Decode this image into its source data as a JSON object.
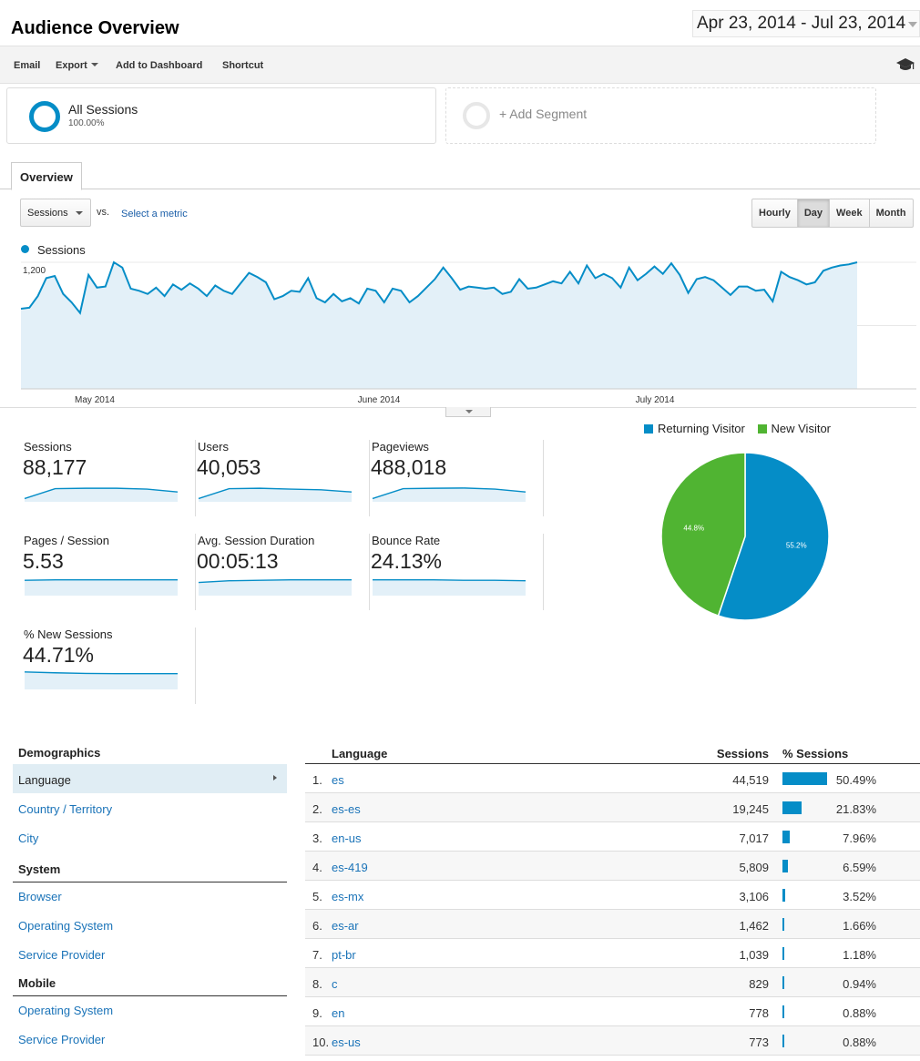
{
  "header": {
    "title": "Audience Overview",
    "date_range": "Apr 23, 2014 - Jul 23, 2014"
  },
  "toolbar": {
    "email": "Email",
    "export": "Export",
    "add_to_dashboard": "Add to Dashboard",
    "shortcut": "Shortcut",
    "icon": "graduation-cap-icon"
  },
  "segments": {
    "all_sessions": {
      "label": "All Sessions",
      "percent": "100.00%"
    },
    "add_segment": "+ Add Segment"
  },
  "tabs": {
    "overview": "Overview"
  },
  "chart_controls": {
    "metric": "Sessions",
    "vs": "vs.",
    "select_metric": "Select a metric",
    "periods": [
      "Hourly",
      "Day",
      "Week",
      "Month"
    ],
    "active_period": "Day"
  },
  "colors": {
    "accent": "#058dc7",
    "new_visitor": "#50b432",
    "link": "#1a73b8"
  },
  "chart_data": [
    {
      "type": "area",
      "series": [
        {
          "name": "Sessions",
          "values": [
            760,
            770,
            880,
            1050,
            1070,
            900,
            820,
            720,
            1080,
            960,
            970,
            1200,
            1150,
            950,
            930,
            900,
            960,
            880,
            990,
            940,
            1000,
            950,
            880,
            980,
            930,
            900,
            1000,
            1100,
            1060,
            1010,
            850,
            880,
            930,
            920,
            1050,
            860,
            820,
            900,
            830,
            860,
            810,
            950,
            930,
            820,
            950,
            930,
            820,
            880,
            960,
            1040,
            1150,
            1050,
            940,
            970,
            960,
            950,
            960,
            900,
            920,
            1040,
            950,
            960,
            990,
            1020,
            1000,
            1110,
            1000,
            1170,
            1050,
            1090,
            1050,
            960,
            1150,
            1030,
            1090,
            1160,
            1090,
            1190,
            1080,
            910,
            1040,
            1060,
            1030,
            960,
            890,
            970,
            970,
            930,
            940,
            830,
            1110,
            1060,
            1030,
            990,
            1010,
            1120,
            1150,
            1170,
            1180,
            1200
          ]
        }
      ],
      "x_labels": [
        "May 2014",
        "June 2014",
        "July 2014"
      ],
      "y_ticks": [
        600,
        1200
      ],
      "legend": "Sessions"
    },
    {
      "type": "pie",
      "categories": [
        "Returning Visitor",
        "New Visitor"
      ],
      "values": [
        55.2,
        44.8
      ],
      "labels": [
        "55.2%",
        "44.8%"
      ]
    }
  ],
  "scorecards": [
    {
      "label": "Sessions",
      "value": "88,177",
      "spark": [
        0.15,
        0.6,
        0.62,
        0.62,
        0.58,
        0.45
      ]
    },
    {
      "label": "Users",
      "value": "40,053",
      "spark": [
        0.15,
        0.6,
        0.62,
        0.58,
        0.55,
        0.45
      ]
    },
    {
      "label": "Pageviews",
      "value": "488,018",
      "spark": [
        0.15,
        0.6,
        0.62,
        0.63,
        0.58,
        0.45
      ]
    },
    {
      "label": "Pages / Session",
      "value": "5.53",
      "spark": [
        0.7,
        0.72,
        0.72,
        0.72,
        0.72,
        0.72
      ]
    },
    {
      "label": "Avg. Session Duration",
      "value": "00:05:13",
      "spark": [
        0.6,
        0.68,
        0.7,
        0.72,
        0.72,
        0.72
      ]
    },
    {
      "label": "Bounce Rate",
      "value": "24.13%",
      "spark": [
        0.72,
        0.72,
        0.72,
        0.7,
        0.7,
        0.68
      ]
    },
    {
      "label": "% New Sessions",
      "value": "44.71%",
      "spark": [
        0.8,
        0.76,
        0.73,
        0.72,
        0.72,
        0.72
      ]
    }
  ],
  "demographics": {
    "sections": [
      {
        "title": "Demographics",
        "items": [
          "Language",
          "Country / Territory",
          "City"
        ]
      },
      {
        "title": "System",
        "items": [
          "Browser",
          "Operating System",
          "Service Provider"
        ]
      },
      {
        "title": "Mobile",
        "items": [
          "Operating System",
          "Service Provider"
        ]
      }
    ],
    "active_item": "Language"
  },
  "language_table": {
    "headers": {
      "language": "Language",
      "sessions": "Sessions",
      "pct_sessions": "% Sessions"
    },
    "rows": [
      {
        "rank": "1.",
        "language": "es",
        "sessions": "44,519",
        "pct": "50.49%",
        "share": 50.49
      },
      {
        "rank": "2.",
        "language": "es-es",
        "sessions": "19,245",
        "pct": "21.83%",
        "share": 21.83
      },
      {
        "rank": "3.",
        "language": "en-us",
        "sessions": "7,017",
        "pct": "7.96%",
        "share": 7.96
      },
      {
        "rank": "4.",
        "language": "es-419",
        "sessions": "5,809",
        "pct": "6.59%",
        "share": 6.59
      },
      {
        "rank": "5.",
        "language": "es-mx",
        "sessions": "3,106",
        "pct": "3.52%",
        "share": 3.52
      },
      {
        "rank": "6.",
        "language": "es-ar",
        "sessions": "1,462",
        "pct": "1.66%",
        "share": 1.66
      },
      {
        "rank": "7.",
        "language": "pt-br",
        "sessions": "1,039",
        "pct": "1.18%",
        "share": 1.18
      },
      {
        "rank": "8.",
        "language": "c",
        "sessions": "829",
        "pct": "0.94%",
        "share": 0.94
      },
      {
        "rank": "9.",
        "language": "en",
        "sessions": "778",
        "pct": "0.88%",
        "share": 0.88
      },
      {
        "rank": "10.",
        "language": "es-us",
        "sessions": "773",
        "pct": "0.88%",
        "share": 0.88
      }
    ]
  }
}
